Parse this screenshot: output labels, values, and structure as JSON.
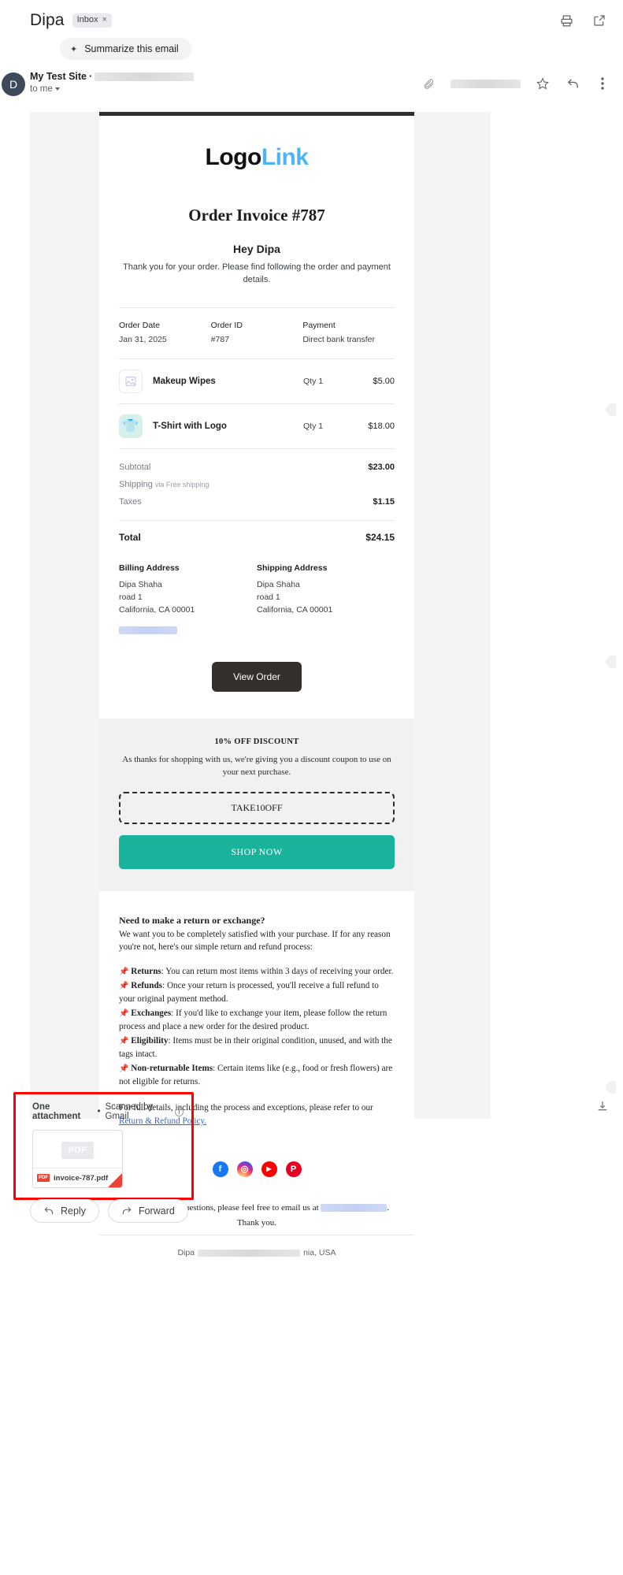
{
  "gmail": {
    "subject": "Dipa",
    "label": "Inbox",
    "label_close": "×",
    "summarize_label": "Summarize this email",
    "sender_name": "My Test Site",
    "sender_sep": "·",
    "to_me": "to me",
    "print_icon": "print-icon",
    "popout_icon": "open-in-new-icon",
    "attachment_clip_icon": "paperclip-icon",
    "star_icon": "star-icon",
    "reply_icon": "reply-icon",
    "more_icon": "more-vert-icon"
  },
  "email": {
    "logo_part1": "Logo",
    "logo_part2": "Link",
    "logo_accent": "#4cb6f5",
    "invoice_title": "Order Invoice #787",
    "greeting": "Hey Dipa",
    "intro": "Thank you for your order. Please find following the order and payment details.",
    "meta": [
      {
        "key": "Order Date",
        "value": "Jan 31, 2025"
      },
      {
        "key": "Order ID",
        "value": "#787"
      },
      {
        "key": "Payment",
        "value": "Direct bank transfer"
      }
    ],
    "products": [
      {
        "name": "Makeup Wipes",
        "qty": "Qty 1",
        "price": "$5.00",
        "icon": "image-placeholder-icon",
        "glyph": ""
      },
      {
        "name": "T-Shirt with Logo",
        "qty": "Qty 1",
        "price": "$18.00",
        "icon": "tshirt-thumbnail",
        "glyph": "👕"
      }
    ],
    "summary": [
      {
        "key": "Subtotal",
        "sub": "",
        "value": "$23.00"
      },
      {
        "key": "Shipping",
        "sub": "via Free shipping",
        "value": ""
      },
      {
        "key": "Taxes",
        "sub": "",
        "value": "$1.15"
      }
    ],
    "total_label": "Total",
    "total_value": "$24.15",
    "billing_heading": "Billing Address",
    "shipping_heading": "Shipping Address",
    "billing_lines": "Dipa Shaha\nroad 1\nCalifornia, CA 00001",
    "shipping_lines": "Dipa Shaha\nroad 1\nCalifornia, CA 00001",
    "view_order": "View Order",
    "promo_heading": "10% OFF DISCOUNT",
    "promo_text": "As thanks for shopping with us, we're giving you a discount coupon to use on your next purchase.",
    "coupon_code": "TAKE10OFF",
    "shop_now": "SHOP NOW",
    "shop_now_color": "#18b39a",
    "policy_heading": "Need to make a return or exchange?",
    "policy_intro": "We want you to be completely satisfied with your purchase. If for any reason you're not, here's our simple return and refund process:",
    "policy_items": [
      {
        "title": "Returns",
        "text": ": You can return most items within 3 days of receiving your order."
      },
      {
        "title": "Refunds",
        "text": ": Once your return is processed, you'll receive a full refund to your original payment method."
      },
      {
        "title": "Exchanges",
        "text": ": If you'd like to exchange your item, please follow the return process and place a new order for the desired product."
      },
      {
        "title": "Eligibility",
        "text": ": Items must be in their original condition, unused, and with the tags intact."
      },
      {
        "title": "Non-returnable Items",
        "text": ": Certain items like (e.g., food or fresh flowers) are not eligible for returns."
      }
    ],
    "policy_full_prefix": "For full details, including the process and exceptions, please refer to our ",
    "policy_link": "Return & Refund Policy.",
    "socials": [
      {
        "name": "facebook-icon",
        "glyph": "f",
        "class": "fb"
      },
      {
        "name": "instagram-icon",
        "glyph": "◎",
        "class": "ig"
      },
      {
        "name": "youtube-icon",
        "glyph": "▶",
        "class": "yt"
      },
      {
        "name": "pinterest-icon",
        "glyph": "P",
        "class": "pi"
      }
    ],
    "contact_prefix": "If you have any questions, please feel free to email us at",
    "contact_suffix": ".",
    "contact_thanks": "Thank you.",
    "footer_prefix": "Dipa",
    "footer_suffix": "nia, USA"
  },
  "attachment": {
    "count_label": "One attachment",
    "separator": "•",
    "scanned_label": "Scanned by Gmail",
    "info_glyph": "i",
    "thumb_badge": "PDF",
    "file_tag": "PDF",
    "file_name": "invoice-787.pdf",
    "download_icon": "download-all-icon",
    "highlight_color": "#ff0000"
  },
  "actions": {
    "reply": "Reply",
    "forward": "Forward",
    "reply_icon": "reply-arrow-icon",
    "forward_icon": "forward-arrow-icon"
  }
}
